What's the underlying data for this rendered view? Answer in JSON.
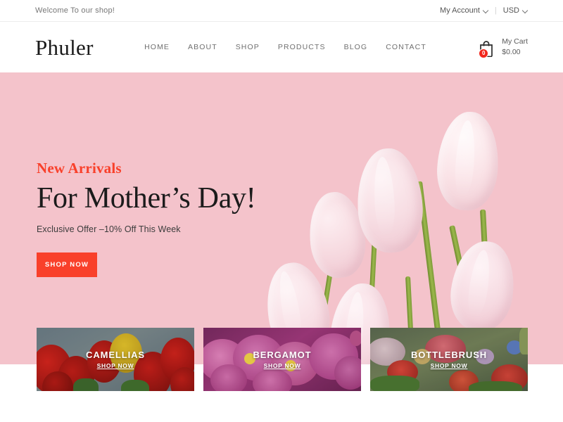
{
  "topbar": {
    "welcome": "Welcome To our shop!",
    "account": "My Account",
    "separator": "|",
    "currency": "USD"
  },
  "header": {
    "logo": "Phuler",
    "nav": [
      {
        "label": "HOME"
      },
      {
        "label": "ABOUT"
      },
      {
        "label": "SHOP"
      },
      {
        "label": "PRODUCTS"
      },
      {
        "label": "BLOG"
      },
      {
        "label": "CONTACT"
      }
    ],
    "cart": {
      "label": "My Cart",
      "total": "$0.00",
      "count": "0"
    }
  },
  "hero": {
    "eyebrow": "New Arrivals",
    "headline": "For Mother’s Day!",
    "subline": "Exclusive Offer –10% Off This Week",
    "cta": "SHOP NOW",
    "background_color": "#f4c3cb",
    "accent_color": "#f9402a"
  },
  "cards": [
    {
      "title": "CAMELLIAS",
      "cta": "SHOP NOW"
    },
    {
      "title": "BERGAMOT",
      "cta": "SHOP NOW"
    },
    {
      "title": "BOTTLEBRUSH",
      "cta": "SHOP NOW"
    }
  ]
}
